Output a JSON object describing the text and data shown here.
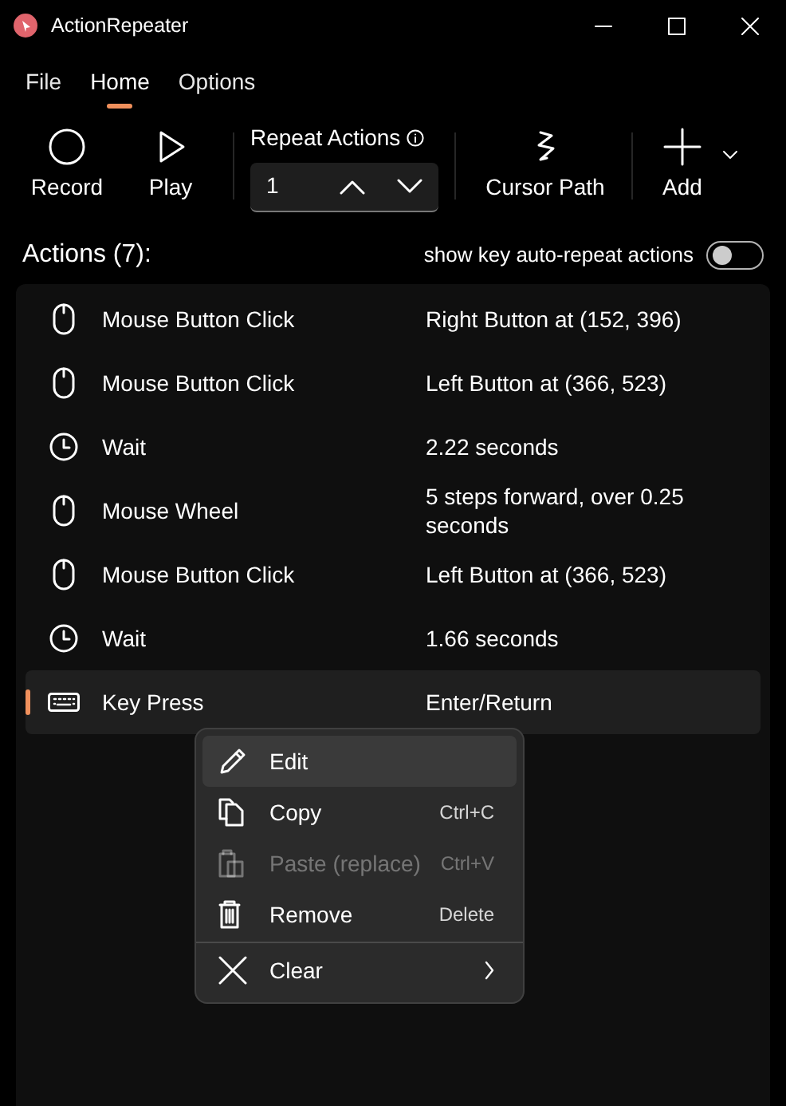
{
  "window": {
    "title": "ActionRepeater"
  },
  "tabs": [
    {
      "label": "File",
      "selected": false
    },
    {
      "label": "Home",
      "selected": true
    },
    {
      "label": "Options",
      "selected": false
    }
  ],
  "toolbar": {
    "record": "Record",
    "play": "Play",
    "repeat_label": "Repeat Actions",
    "repeat_value": "1",
    "cursor_path": "Cursor Path",
    "add": "Add"
  },
  "actions_header": "Actions (7):",
  "auto_repeat_toggle": {
    "label": "show key auto-repeat actions",
    "on": false
  },
  "actions": [
    {
      "kind": "mouse",
      "name": "Mouse Button Click",
      "detail": "Right Button at (152, 396)",
      "selected": false
    },
    {
      "kind": "mouse",
      "name": "Mouse Button Click",
      "detail": "Left Button at (366, 523)",
      "selected": false
    },
    {
      "kind": "wait",
      "name": "Wait",
      "detail": "2.22 seconds",
      "selected": false
    },
    {
      "kind": "mouse",
      "name": "Mouse Wheel",
      "detail": "5 steps forward, over 0.25 seconds",
      "selected": false
    },
    {
      "kind": "mouse",
      "name": "Mouse Button Click",
      "detail": "Left Button at (366, 523)",
      "selected": false
    },
    {
      "kind": "wait",
      "name": "Wait",
      "detail": "1.66 seconds",
      "selected": false
    },
    {
      "kind": "key",
      "name": "Key Press",
      "detail": "Enter/Return",
      "selected": true
    }
  ],
  "context_menu": [
    {
      "kind": "pencil",
      "label": "Edit",
      "selected": true,
      "disabled": false
    },
    {
      "kind": "copy",
      "label": "Copy",
      "shortcut": "Ctrl+C",
      "selected": false,
      "disabled": false
    },
    {
      "kind": "paste",
      "label": "Paste (replace)",
      "shortcut": "Ctrl+V",
      "selected": false,
      "disabled": true
    },
    {
      "kind": "trash",
      "label": "Remove",
      "shortcut": "Delete",
      "selected": false,
      "disabled": false
    },
    {
      "kind": "x",
      "label": "Clear",
      "submenu": true,
      "separator_before": true,
      "selected": false,
      "disabled": false
    }
  ]
}
